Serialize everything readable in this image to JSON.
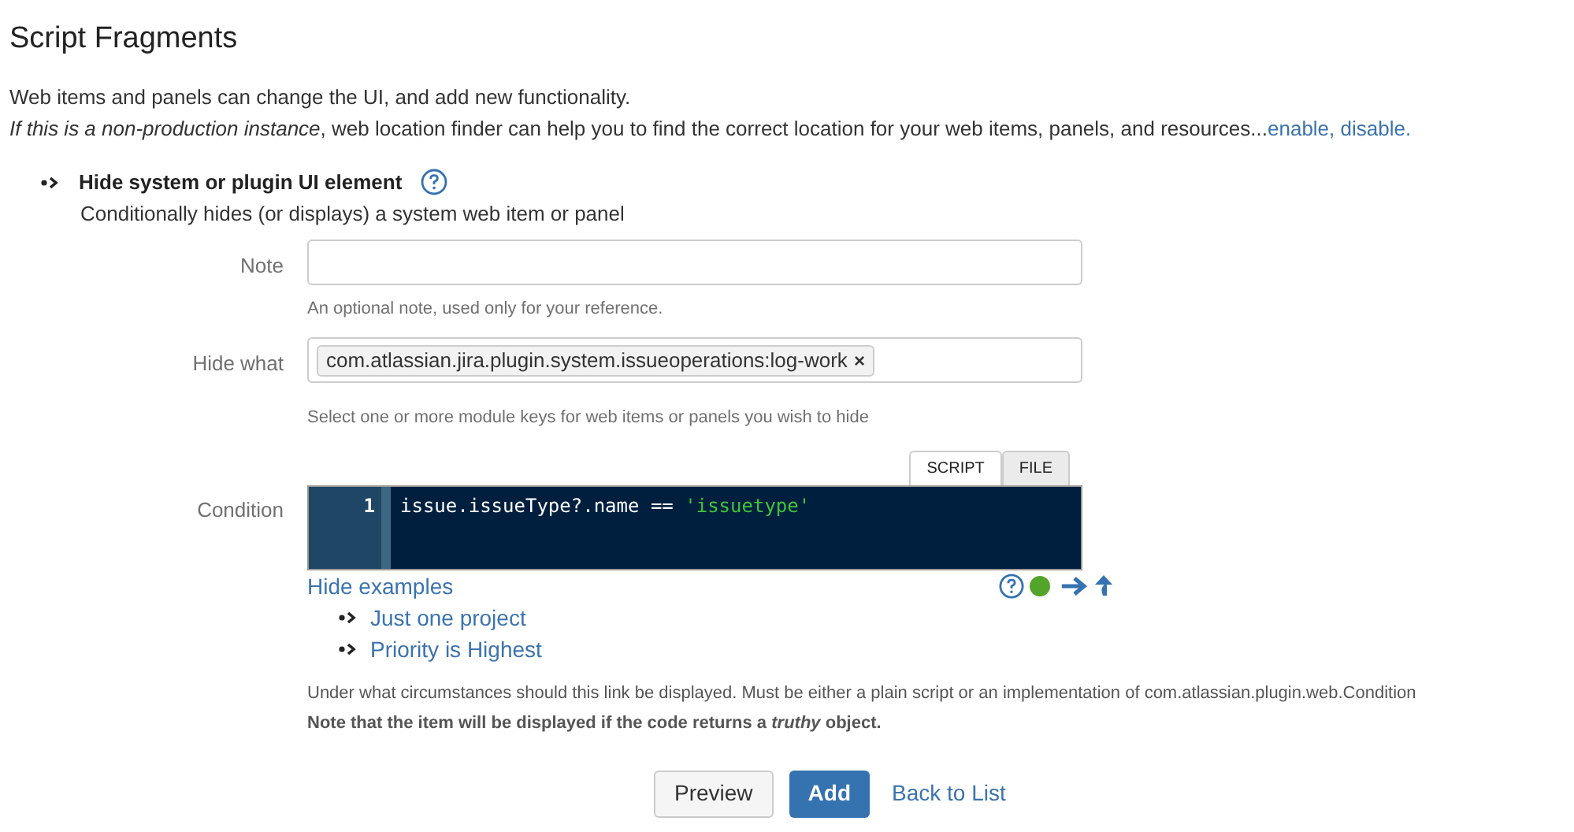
{
  "page_title": "Script Fragments",
  "intro": {
    "line_1": "Web items and panels can change the UI, and add new functionality.",
    "line_2": "*If this is a non-production instance*, web location finder can help you to find the correct location for your web items, panels, and resources...",
    "links": [
      "enable,",
      "disable."
    ]
  },
  "fragment": {
    "title": "Hide system or plugin UI element",
    "description": "Conditionally hides (or displays) a system web item or panel"
  },
  "form": {
    "note": {
      "label": "Note",
      "help": "An optional note, used only for your reference."
    },
    "hide_what": {
      "label": "Hide what",
      "tags": [
        {
          "text": "com.atlassian.jira.plugin.system.issueoperations:log-work",
          "remove": "×"
        }
      ],
      "help": "Select one or more module keys for web items or panels you wish to hide"
    },
    "condition": {
      "label": "Condition",
      "tabs": [
        {
          "label": "SCRIPT",
          "selected": true
        },
        {
          "label": "FILE",
          "selected": false
        }
      ],
      "lines": [
        {
          "number": "1",
          "tokens": [
            {
              "text": "issue.issueType?.name == ",
              "kind": "plain"
            },
            {
              "text": "'issuetype'",
              "kind": "string"
            }
          ]
        }
      ],
      "examples_toggle": "Hide examples",
      "examples": [
        "Just one project",
        "Priority is Highest"
      ],
      "help": "Under what circumstances should this link be displayed. Must be either a plain script or an implementation of com.atlassian.plugin.web.Condition",
      "note": "Note that the item will be displayed if the code returns a *truthy* object."
    }
  },
  "buttons": [
    {
      "label": "Preview",
      "kind": "secondary"
    },
    {
      "label": "Add",
      "kind": "primary"
    },
    {
      "label": "Back to List",
      "kind": "link"
    }
  ]
}
